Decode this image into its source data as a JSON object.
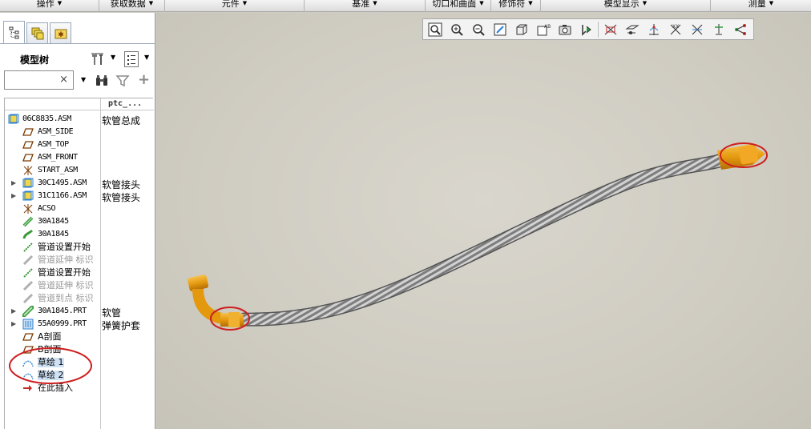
{
  "ribbon": {
    "groups": [
      {
        "label": "操作"
      },
      {
        "label": "获取数据"
      },
      {
        "label": "元件"
      },
      {
        "label": "基准"
      },
      {
        "label": "切口和曲面"
      },
      {
        "label": "修饰符"
      },
      {
        "label": "模型显示"
      },
      {
        "label": "测量"
      }
    ]
  },
  "leftpanel": {
    "tabs": [
      "model-tree-tab",
      "layer-tree-tab",
      "favorites-tab"
    ],
    "title": "模型树",
    "search_value": "",
    "clear_glyph": "×",
    "column2_header": "ptc_..."
  },
  "tree": {
    "rows": [
      {
        "text": "06C8835.ASM",
        "col2": "软管总成",
        "icon": "assembly-icon",
        "expand": ""
      },
      {
        "text": "ASM_SIDE",
        "col2": "",
        "icon": "datum-plane-icon",
        "expand": ""
      },
      {
        "text": "ASM_TOP",
        "col2": "",
        "icon": "datum-plane-icon",
        "expand": ""
      },
      {
        "text": "ASM_FRONT",
        "col2": "",
        "icon": "datum-plane-icon",
        "expand": ""
      },
      {
        "text": "START_ASM",
        "col2": "",
        "icon": "coord-system-icon",
        "expand": ""
      },
      {
        "text": "30C1495.ASM",
        "col2": "软管接头",
        "icon": "assembly-icon",
        "expand": "▶"
      },
      {
        "text": "31C1166.ASM",
        "col2": "软管接头",
        "icon": "assembly-icon",
        "expand": "▶"
      },
      {
        "text": "ACSO",
        "col2": "",
        "icon": "coord-system-icon",
        "expand": ""
      },
      {
        "text": "30A1845",
        "col2": "",
        "icon": "hose-icon",
        "expand": ""
      },
      {
        "text": "30A1845",
        "col2": "",
        "icon": "pipe-bend-icon",
        "expand": ""
      },
      {
        "text": "管道设置开始",
        "col2": "",
        "icon": "pipe-start-icon",
        "expand": ""
      },
      {
        "text": "管道延伸 标识",
        "col2": "",
        "icon": "pipe-extend-icon",
        "expand": "",
        "dim": true
      },
      {
        "text": "管道设置开始",
        "col2": "",
        "icon": "pipe-start-icon",
        "expand": ""
      },
      {
        "text": "管道延伸 标识",
        "col2": "",
        "icon": "pipe-extend-icon",
        "expand": "",
        "dim": true
      },
      {
        "text": "管道到点 标识",
        "col2": "",
        "icon": "pipe-extend-icon",
        "expand": "",
        "dim": true
      },
      {
        "text": "30A1845.PRT",
        "col2": "软管",
        "icon": "hose-part-icon",
        "expand": "▶"
      },
      {
        "text": "55A0999.PRT",
        "col2": "弹簧护套",
        "icon": "spring-part-icon",
        "expand": "▶"
      },
      {
        "text": "A剖面",
        "col2": "",
        "icon": "section-icon",
        "expand": ""
      },
      {
        "text": "B剖面",
        "col2": "",
        "icon": "section-icon",
        "expand": ""
      },
      {
        "text": "草绘 1",
        "col2": "",
        "icon": "sketch-icon",
        "expand": "",
        "sel": true
      },
      {
        "text": "草绘 2",
        "col2": "",
        "icon": "sketch-icon",
        "expand": "",
        "sel": true
      },
      {
        "text": "在此插入",
        "col2": "",
        "icon": "insert-here-icon",
        "expand": ""
      }
    ]
  },
  "graphics_toolbar": {
    "icons": [
      "refit-icon",
      "zoom-in-icon",
      "zoom-out-icon",
      "repaint-icon",
      "display-style-icon",
      "saved-views-icon",
      "named-view-icon",
      "spin-center-icon",
      "datum-planes-icon",
      "datum-axes-icon",
      "datum-points-icon",
      "coord-systems-icon",
      "annotations-icon",
      "measure-icon"
    ]
  },
  "colors": {
    "hose_gray": "#9a9a9a",
    "fitting_orange": "#e8a21a",
    "highlight_red": "#cc1f1f",
    "selection_blue": "#cfe2f5"
  }
}
